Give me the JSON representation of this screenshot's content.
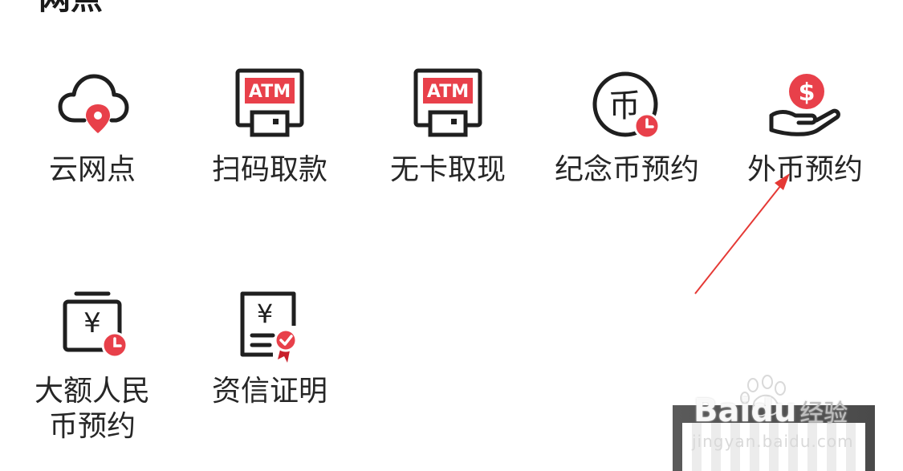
{
  "section": {
    "title": "网点"
  },
  "tiles": [
    {
      "label": "云网点",
      "icon": "cloud-location-icon"
    },
    {
      "label": "扫码取款",
      "icon": "atm-qr-icon",
      "icon_text": "ATM"
    },
    {
      "label": "无卡取现",
      "icon": "atm-cardless-icon",
      "icon_text": "ATM"
    },
    {
      "label": "纪念币预约",
      "icon": "coin-clock-icon",
      "icon_text": "币"
    },
    {
      "label": "外币预约",
      "icon": "dollar-hand-icon",
      "icon_text": "$"
    },
    {
      "label": "大额人民\n币预约",
      "icon": "rmb-clock-icon",
      "icon_text": "¥"
    },
    {
      "label": "资信证明",
      "icon": "rmb-certificate-icon",
      "icon_text": "¥"
    }
  ],
  "watermark": {
    "brand": "Baidu",
    "brand_cn": "经验",
    "url": "jingyan.baidu.com"
  },
  "colors": {
    "accent": "#e8404a",
    "accent_dark": "#c8202c",
    "stroke": "#1f1f1f",
    "arrow": "#e53935"
  }
}
